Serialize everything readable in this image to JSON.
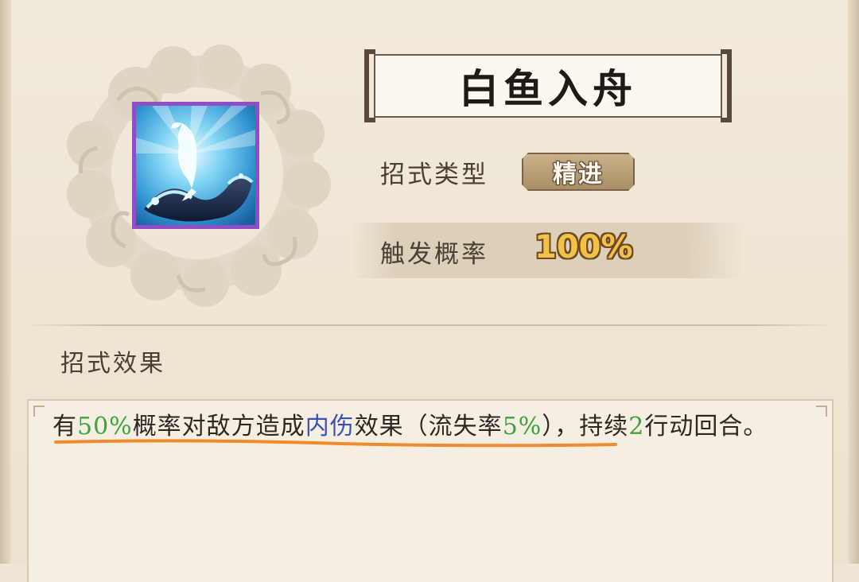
{
  "skill": {
    "name": "白鱼入舟",
    "type_label": "招式类型",
    "type_value": "精进",
    "rate_label": "触发概率",
    "rate_value": "100%",
    "icon": "leaping-fish-wave-icon"
  },
  "effect": {
    "section_title": "招式效果",
    "parts": {
      "p1": "有",
      "p2": "50%",
      "p3": "概率对敌方造成",
      "p4": "内伤",
      "p5": "效果（流失率",
      "p6": "5%",
      "p7": "），持续",
      "p8": "2",
      "p9": "行动回合。"
    }
  },
  "colors": {
    "highlight_green": "#3da33a",
    "highlight_blue": "#3a4fb8",
    "rate_gold": "#f2c14a",
    "icon_border_purple": "#8e4fc4",
    "underline_orange": "#f08a2a"
  }
}
